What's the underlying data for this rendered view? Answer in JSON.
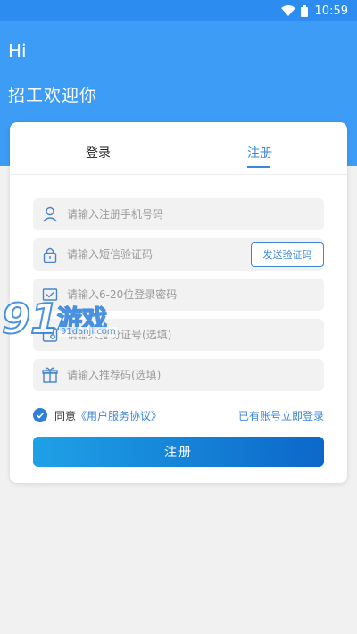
{
  "status_bar": {
    "time": "10:59",
    "icons": [
      "wifi-icon",
      "battery-icon"
    ]
  },
  "header": {
    "greeting": "Hi",
    "welcome": "招工欢迎你"
  },
  "tabs": [
    {
      "label": "登录",
      "active": false
    },
    {
      "label": "注册",
      "active": true
    }
  ],
  "form": {
    "phone": {
      "placeholder": "请输入注册手机号码",
      "icon": "user-icon"
    },
    "sms_code": {
      "placeholder": "请输入短信验证码",
      "icon": "lock-icon",
      "send_label": "发送验证码"
    },
    "password": {
      "placeholder": "请输入6-20位登录密码",
      "icon": "envelope-check-icon"
    },
    "id_number": {
      "placeholder": "请输入身份证号(选填)",
      "icon": "id-card-icon"
    },
    "referral": {
      "placeholder": "请输入推荐码(选填)",
      "icon": "gift-icon"
    }
  },
  "agreement": {
    "checked": true,
    "prefix": "同意",
    "link": "《用户服务协议》",
    "login_link": "已有账号立即登录"
  },
  "submit_label": "注册",
  "watermark": {
    "number": "91",
    "text": "游戏",
    "url": "91danji.com"
  },
  "colors": {
    "primary": "#3d9cf5",
    "accent": "#3b87d9",
    "gradient_start": "#1fa1e6",
    "gradient_end": "#0c67c9"
  }
}
